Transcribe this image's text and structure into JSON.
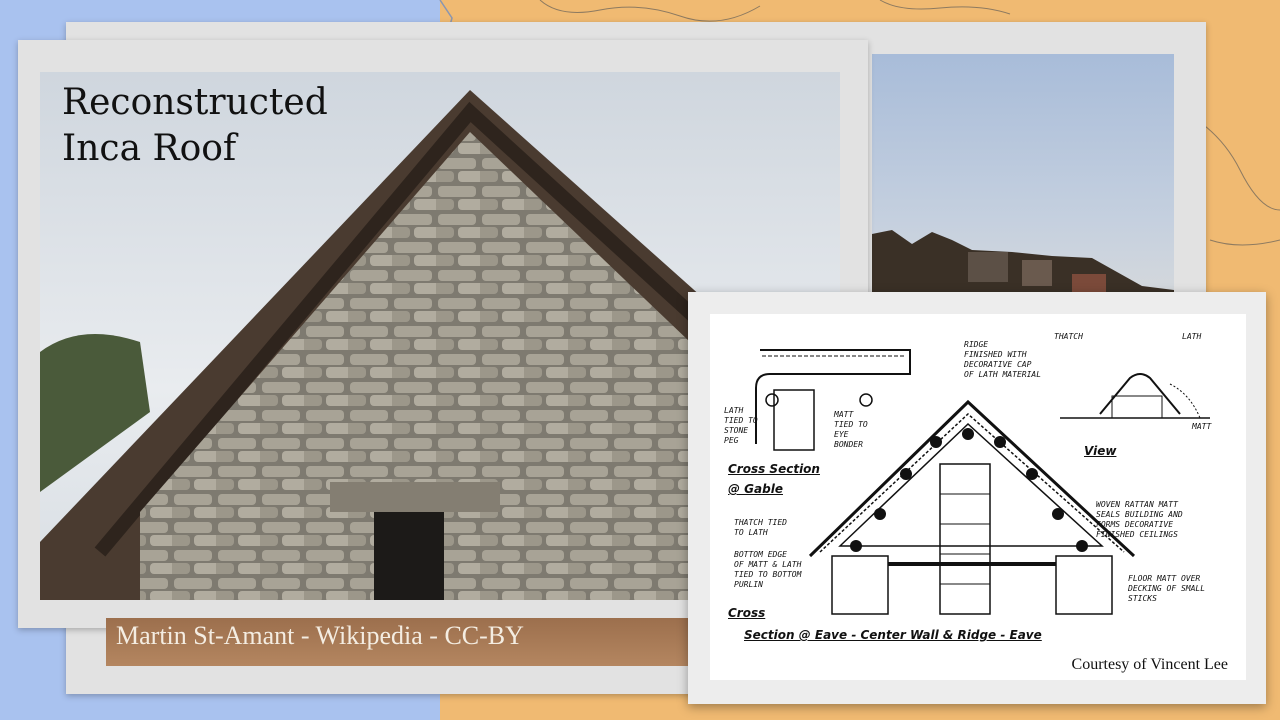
{
  "slide": {
    "title": "Reconstructed\nInca Roof",
    "photo_credit": "Martin St-Amant - Wikipedia - CC-BY"
  },
  "diagram": {
    "credit": "Courtesy of Vincent Lee",
    "labels": {
      "ridge": "Ridge\nfinished with\ndecorative cap\nof lath material",
      "thatch_top": "Thatch",
      "lath_top": "Lath",
      "lath_tied": "Lath\ntied to\nstone\npeg",
      "matt_tied": "Matt\ntied to\neye\nbonder",
      "matt_view": "Matt",
      "woven": "Woven rattan matt\nseals building and\nforms decorative\nfinished ceilings",
      "thatch_tied": "Thatch tied\nto lath",
      "bottom_edge": "Bottom edge\nof matt & lath\ntied to bottom\npurlin",
      "floor_matt": "Floor matt over\ndecking of small\nsticks"
    },
    "headings": {
      "cross_section_gable": "Cross Section",
      "at_gable": "@ Gable",
      "view": "View",
      "cross": "Cross",
      "section_eave": "Section @ Eave  -  Center Wall & Ridge  -  Eave"
    }
  },
  "colors": {
    "background": "#a9c2ef",
    "map_land": "#f0ba72",
    "card": "#e2e2e2"
  }
}
